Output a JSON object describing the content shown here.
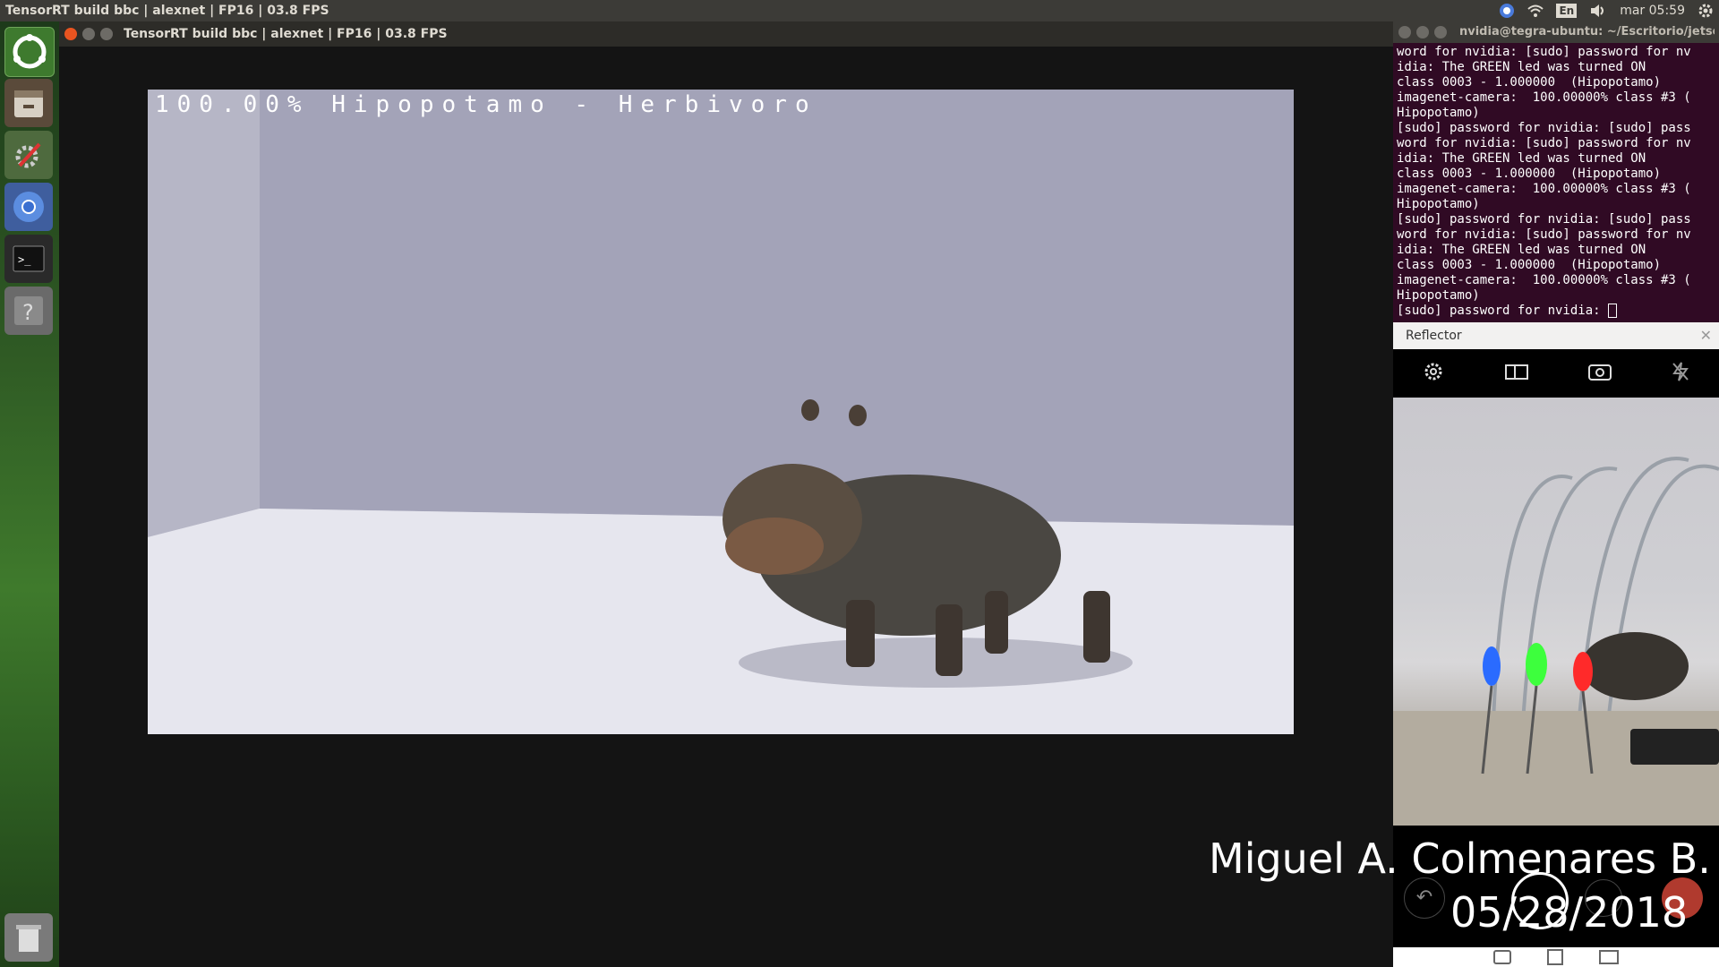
{
  "topbar": {
    "title": "TensorRT build bbc | alexnet | FP16 | 03.8 FPS",
    "keyboard_layout": "En",
    "clock": "mar 05:59"
  },
  "window": {
    "title": "TensorRT build bbc | alexnet | FP16 | 03.8 FPS",
    "overlay_text": "100.00% Hipopotamo - Herbivoro"
  },
  "terminal": {
    "title": "nvidia@tegra-ubuntu: ~/Escritorio/jetson",
    "lines": [
      "word for nvidia: [sudo] password for nv",
      "idia: The GREEN led was turned ON",
      "class 0003 - 1.000000  (Hipopotamo)",
      "imagenet-camera:  100.00000% class #3 (",
      "Hipopotamo)",
      "[sudo] password for nvidia: [sudo] pass",
      "word for nvidia: [sudo] password for nv",
      "idia: The GREEN led was turned ON",
      "class 0003 - 1.000000  (Hipopotamo)",
      "imagenet-camera:  100.00000% class #3 (",
      "Hipopotamo)",
      "[sudo] password for nvidia: [sudo] pass",
      "word for nvidia: [sudo] password for nv",
      "idia: The GREEN led was turned ON",
      "class 0003 - 1.000000  (Hipopotamo)",
      "imagenet-camera:  100.00000% class #3 (",
      "Hipopotamo)",
      "[sudo] password for nvidia: "
    ]
  },
  "reflector": {
    "title": "Reflector"
  },
  "watermark": {
    "name": "Miguel A. Colmenares B.",
    "date": "05/28/2018"
  },
  "colors": {
    "close": "#e95420",
    "terminal_bg": "#300a24",
    "led_green": "#3dff3d",
    "led_red": "#ff2a2a",
    "led_blue": "#2a6bff"
  }
}
